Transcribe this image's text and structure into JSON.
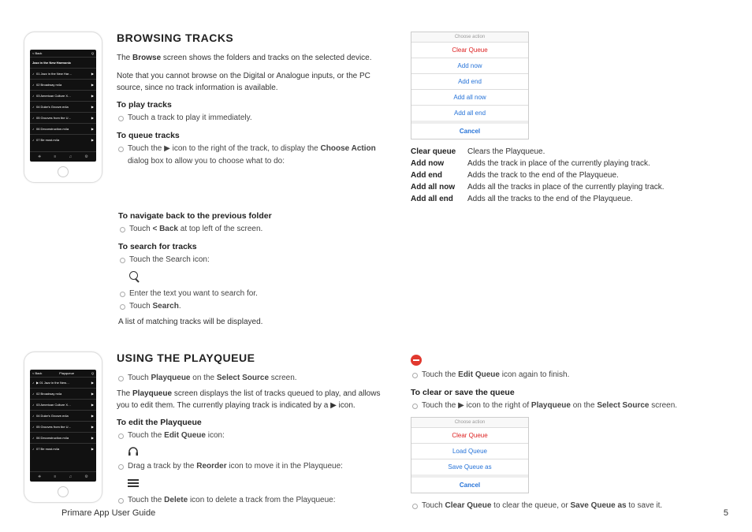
{
  "footer": {
    "guide": "Primare App User Guide",
    "page": "5"
  },
  "phone1": {
    "back": "< Back",
    "title": "Jazz in the New Harmonic",
    "rows": [
      "01 Jazz in the New Har…",
      "02 Broadway m4a",
      "03 American Culture X…",
      "04 Duke's Groove.m4a",
      "05 Grooves from the U…",
      "06 Deconstruction.m4a",
      "07 Be most.m4a"
    ]
  },
  "phone2": {
    "back": "< Back",
    "title": "Playqueue",
    "rows": [
      "▶ 01 Jazz in the New…",
      "02 Broadway m4a",
      "03 American Culture X…",
      "04 Duke's Groove.m4a",
      "05 Grooves from the U…",
      "06 Deconstruction.m4a",
      "07 Be most.m4a"
    ]
  },
  "s1": {
    "heading": "BROWSING TRACKS",
    "p1a": "The ",
    "p1b": "Browse",
    "p1c": " screen shows the folders and tracks on the selected device.",
    "p2": "Note that you cannot browse on the Digital or Analogue inputs, or the PC source, since no track information is available.",
    "play_h": "To play tracks",
    "play_li": "Touch a track to play it immediately.",
    "queue_h": "To queue tracks",
    "queue_li_a": "Touch the ",
    "queue_li_b": " icon to the right of the track, to display the ",
    "queue_li_c": "Choose Action",
    "queue_li_d": " dialog box to allow you to choose what to do:",
    "nav_h": "To navigate back to the previous folder",
    "nav_li_a": "Touch ",
    "nav_li_b": "< Back",
    "nav_li_c": " at top left of the screen.",
    "search_h": "To search for tracks",
    "search_li1": "Touch the Search icon:",
    "search_li2": "Enter the text you want to search for.",
    "search_li3a": "Touch ",
    "search_li3b": "Search",
    "search_li3c": ".",
    "search_tail": "A list of matching tracks will be displayed."
  },
  "popup1": {
    "title": "Choose action",
    "items": [
      {
        "label": "Clear Queue",
        "cls": "red"
      },
      {
        "label": "Add now",
        "cls": "blue"
      },
      {
        "label": "Add end",
        "cls": "blue"
      },
      {
        "label": "Add all now",
        "cls": "blue"
      },
      {
        "label": "Add all end",
        "cls": "blue"
      }
    ],
    "cancel": "Cancel"
  },
  "defs": [
    {
      "k": "Clear queue",
      "v": "Clears the Playqueue."
    },
    {
      "k": "Add now",
      "v": "Adds the track in place of the currently playing track."
    },
    {
      "k": "Add end",
      "v": "Adds the track to the end of the Playqueue."
    },
    {
      "k": "Add all now",
      "v": "Adds all the tracks in place of the currently playing track."
    },
    {
      "k": "Add all end",
      "v": "Adds all the tracks to the end of the Playqueue."
    }
  ],
  "s2": {
    "heading": "USING THE PLAYQUEUE",
    "li1a": "Touch ",
    "li1b": "Playqueue",
    "li1c": " on the ",
    "li1d": "Select Source",
    "li1e": " screen.",
    "p1a": "The ",
    "p1b": "Playqueue",
    "p1c": " screen displays the list of tracks queued to play, and allows you to edit them. The currently playing track is indicated by a ",
    "p1d": " icon.",
    "edit_h": "To edit the Playqueue",
    "edit_li_a": "Touch the ",
    "edit_li_b": "Edit Queue",
    "edit_li_c": " icon:",
    "reorder_li_a": "Drag a track by the ",
    "reorder_li_b": "Reorder",
    "reorder_li_c": " icon to move it in the Playqueue:",
    "delete_li_a": "Touch the ",
    "delete_li_b": "Delete",
    "delete_li_c": " icon to delete a track from the Playqueue:",
    "finish_li_a": "Touch the ",
    "finish_li_b": "Edit Queue",
    "finish_li_c": " icon again to finish.",
    "clear_h": "To clear or save the queue",
    "clear_li_a": "Touch the ",
    "clear_li_b": " icon to the right of ",
    "clear_li_c": "Playqueue",
    "clear_li_d": " on the ",
    "clear_li_e": "Select Source",
    "clear_li_f": " screen.",
    "tail_a": "Touch ",
    "tail_b": "Clear Queue",
    "tail_c": " to clear the queue, or ",
    "tail_d": "Save Queue as",
    "tail_e": " to save it."
  },
  "popup2": {
    "title": "Choose action",
    "items": [
      {
        "label": "Clear Queue",
        "cls": "red"
      },
      {
        "label": "Load Queue",
        "cls": "blue"
      },
      {
        "label": "Save Queue as",
        "cls": "blue"
      }
    ],
    "cancel": "Cancel"
  }
}
